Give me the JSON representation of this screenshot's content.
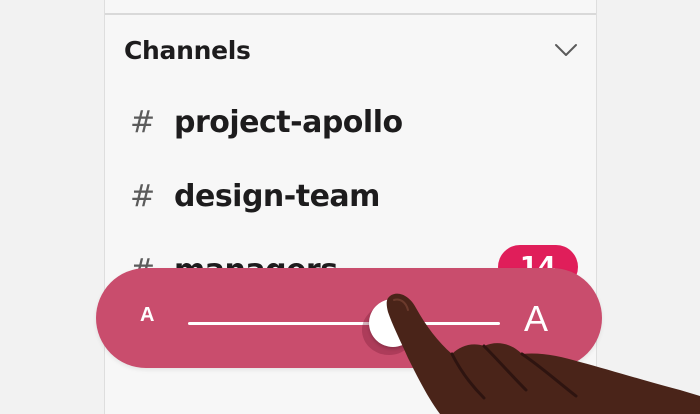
{
  "sidebar": {
    "section": {
      "title": "Channels",
      "toggle_icon": "chevron-down-icon"
    },
    "channels": [
      {
        "prefix": "#",
        "name": "project-apollo"
      },
      {
        "prefix": "#",
        "name": "design-team"
      },
      {
        "prefix": "#",
        "name": "managers",
        "badge": "14"
      }
    ]
  },
  "text_size_slider": {
    "small_label": "A",
    "large_label": "A",
    "value_fraction": 0.64
  },
  "colors": {
    "slider_background": "#c94d6d",
    "badge": "#e01e5a",
    "hand": "#4a2419"
  }
}
